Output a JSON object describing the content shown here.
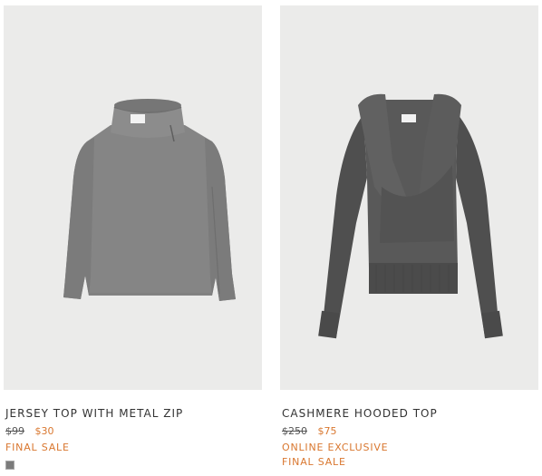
{
  "products": [
    {
      "title": "JERSEY TOP WITH METAL ZIP",
      "old_price": "$99",
      "new_price": "$30",
      "tags": [
        "FINAL SALE"
      ],
      "swatch_color": "#7b7b7b",
      "garment_color": "#858585"
    },
    {
      "title": "CASHMERE HOODED TOP",
      "old_price": "$250",
      "new_price": "$75",
      "tags": [
        "ONLINE EXCLUSIVE",
        "FINAL SALE"
      ],
      "garment_color": "#575757"
    }
  ],
  "colors": {
    "image_bg": "#ebebea",
    "sale_accent": "#d9772f",
    "title_text": "#333333"
  }
}
